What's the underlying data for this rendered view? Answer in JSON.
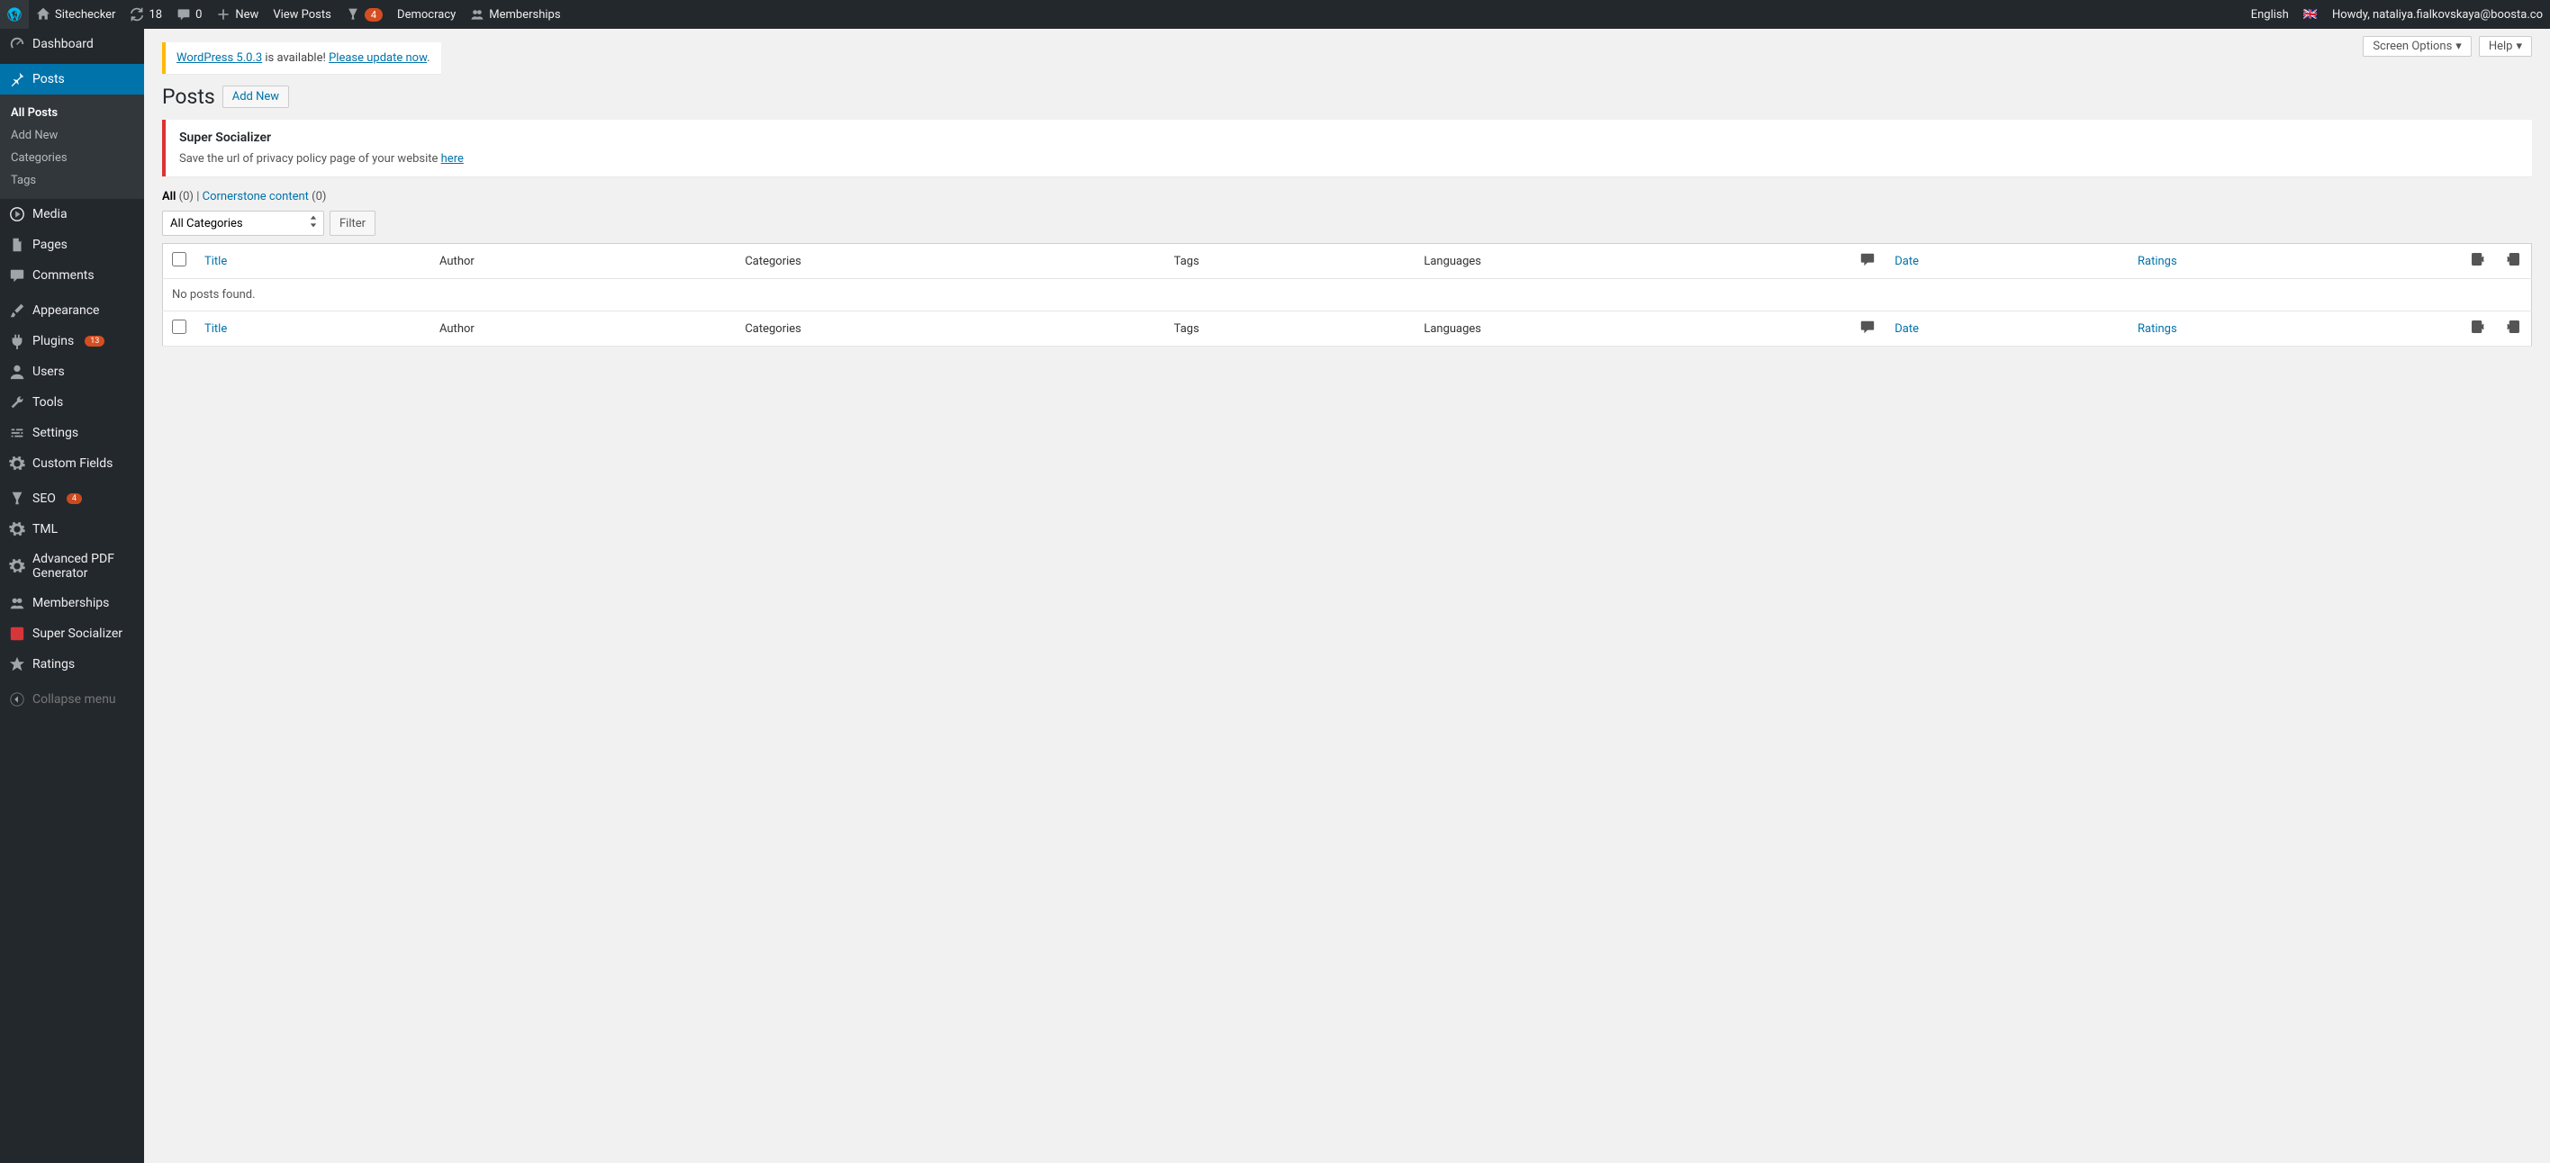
{
  "adminBar": {
    "siteName": "Sitechecker",
    "updatesCount": "18",
    "commentsCount": "0",
    "newLabel": "New",
    "viewPosts": "View Posts",
    "yoastCount": "4",
    "democracy": "Democracy",
    "memberships": "Memberships",
    "language": "English",
    "howdy": "Howdy, nataliya.fialkovskaya@boosta.co"
  },
  "sidebar": {
    "dashboard": "Dashboard",
    "posts": "Posts",
    "postsSub": {
      "allPosts": "All Posts",
      "addNew": "Add New",
      "categories": "Categories",
      "tags": "Tags"
    },
    "media": "Media",
    "pages": "Pages",
    "comments": "Comments",
    "appearance": "Appearance",
    "plugins": "Plugins",
    "pluginsBadge": "13",
    "users": "Users",
    "tools": "Tools",
    "settings": "Settings",
    "customFields": "Custom Fields",
    "seo": "SEO",
    "seoBadge": "4",
    "tml": "TML",
    "pdfGen": "Advanced PDF Generator",
    "memberships": "Memberships",
    "superSocializer": "Super Socializer",
    "ratings": "Ratings",
    "collapse": "Collapse menu"
  },
  "topButtons": {
    "screenOptions": "Screen Options",
    "help": "Help"
  },
  "updateNotice": {
    "versionLink": "WordPress 5.0.3",
    "available": " is available! ",
    "updateLink": "Please update now",
    "dot": "."
  },
  "page": {
    "title": "Posts",
    "addNew": "Add New"
  },
  "notice": {
    "heading": "Super Socializer",
    "text": "Save the url of privacy policy page of your website ",
    "link": "here"
  },
  "subsubsub": {
    "allLabel": "All",
    "allCount": "(0)",
    "sep": "  |  ",
    "cornerstone": "Cornerstone content",
    "cornerstoneCount": " (0)"
  },
  "filter": {
    "allCategories": "All Categories",
    "button": "Filter"
  },
  "table": {
    "title": "Title",
    "author": "Author",
    "categories": "Categories",
    "tags": "Tags",
    "languages": "Languages",
    "date": "Date",
    "ratings": "Ratings",
    "noPosts": "No posts found."
  }
}
